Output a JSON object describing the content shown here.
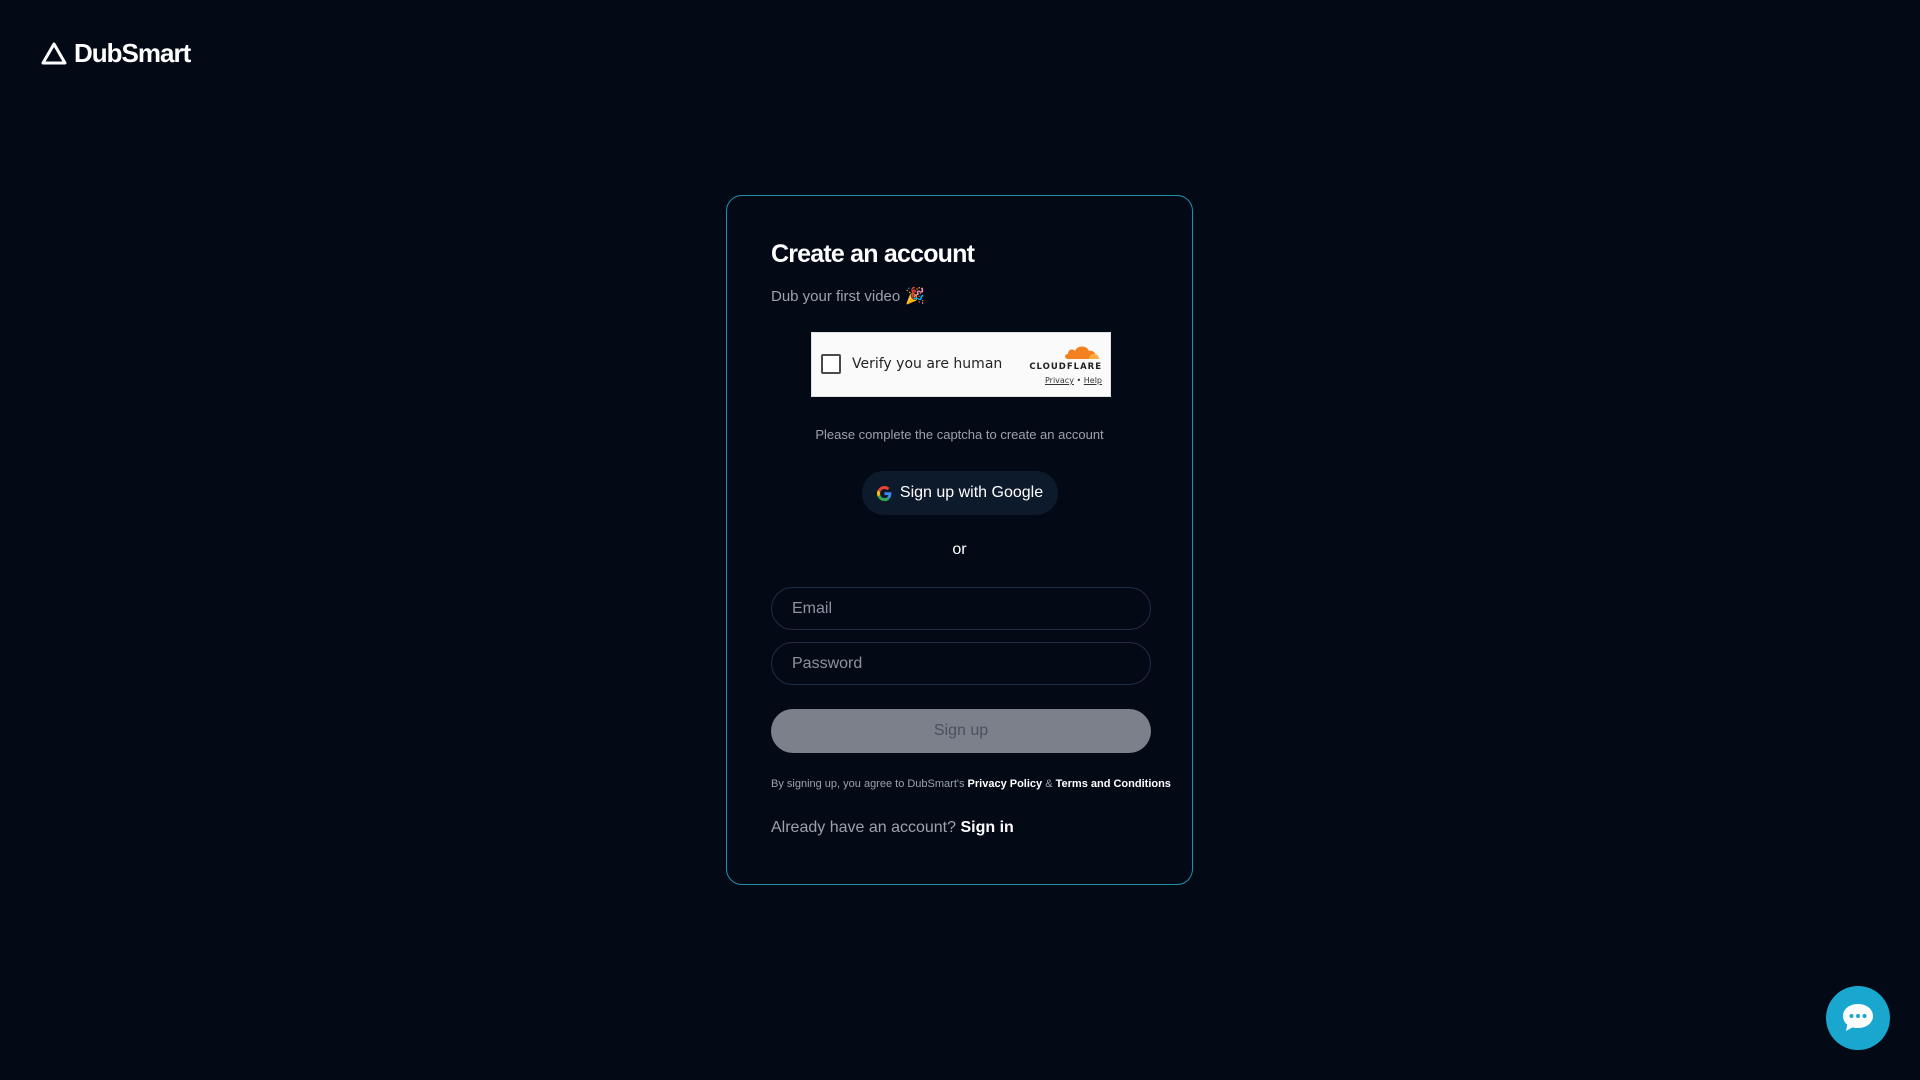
{
  "brand": {
    "name": "DubSmart",
    "logo_icon": "triangle-logo-icon"
  },
  "card": {
    "title": "Create an account",
    "subtitle": "Dub your first video",
    "subtitle_icon": "party-popper-icon"
  },
  "captcha": {
    "label": "Verify you are human",
    "brand": "CLOUDFLARE",
    "privacy": "Privacy",
    "separator": "•",
    "help": "Help",
    "checked": false
  },
  "captcha_note": "Please complete the captcha to create an account",
  "google_button": {
    "label": "Sign up with Google",
    "icon": "google-icon"
  },
  "divider_text": "or",
  "form": {
    "email_placeholder": "Email",
    "email_value": "",
    "password_placeholder": "Password",
    "password_value": "",
    "submit_label": "Sign up"
  },
  "legal": {
    "prefix": "By signing up, you agree to DubSmart's",
    "privacy_policy": "Privacy Policy",
    "ampersand": "&",
    "terms": "Terms and Conditions"
  },
  "signin": {
    "prompt": "Already have an account?",
    "link": "Sign in"
  },
  "chat": {
    "icon": "chat-bubble-icon"
  },
  "colors": {
    "background": "#030a16",
    "card_border": "#1f8fb0",
    "accent": "#19a7d0",
    "cloudflare_orange": "#f48120",
    "muted_text": "#9aa2ae",
    "disabled_button": "#7b808a"
  }
}
